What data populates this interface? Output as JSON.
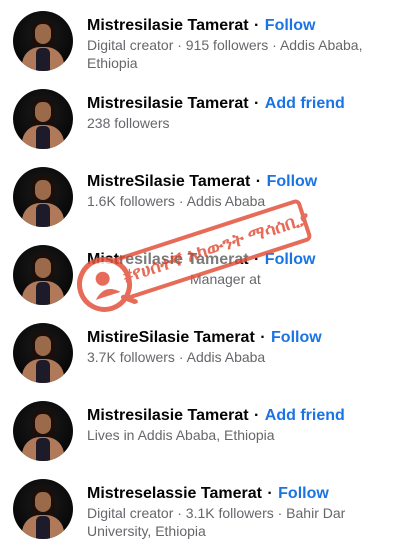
{
  "results": [
    {
      "name": "Mistresilasie Tamerat",
      "separator": "·",
      "action": "Follow",
      "meta": "Digital creator · 915 followers · Addis Ababa, Ethiopia"
    },
    {
      "name": "Mistresilasie Tamerat",
      "separator": "·",
      "action": "Add friend",
      "meta": "238 followers"
    },
    {
      "name": "MistreSilasie Tamerat",
      "separator": "·",
      "action": "Follow",
      "meta": "1.6K followers · Addis Ababa"
    },
    {
      "name": "Mistresilasie Tamerat",
      "separator": "·",
      "action": "Follow",
      "meta": "Manager at"
    },
    {
      "name": "MistireSilasie Tamerat",
      "separator": "·",
      "action": "Follow",
      "meta": "3.7K followers · Addis Ababa"
    },
    {
      "name": "Mistresilasie Tamerat",
      "separator": "·",
      "action": "Add friend",
      "meta": "Lives in Addis Ababa, Ethiopia"
    },
    {
      "name": "Mistreselassie Tamerat",
      "separator": "·",
      "action": "Follow",
      "meta": "Digital creator · 3.1K followers · Bahir Dar University, Ethiopia"
    }
  ],
  "stamp": {
    "text": "#የሀሰተኛ አካውንት ማሳሰቢያ",
    "icon": "fake-account-user-icon"
  },
  "colors": {
    "action": "#1b74e4",
    "name": "#050505",
    "meta": "#65676b",
    "stamp": "#e2553e"
  }
}
